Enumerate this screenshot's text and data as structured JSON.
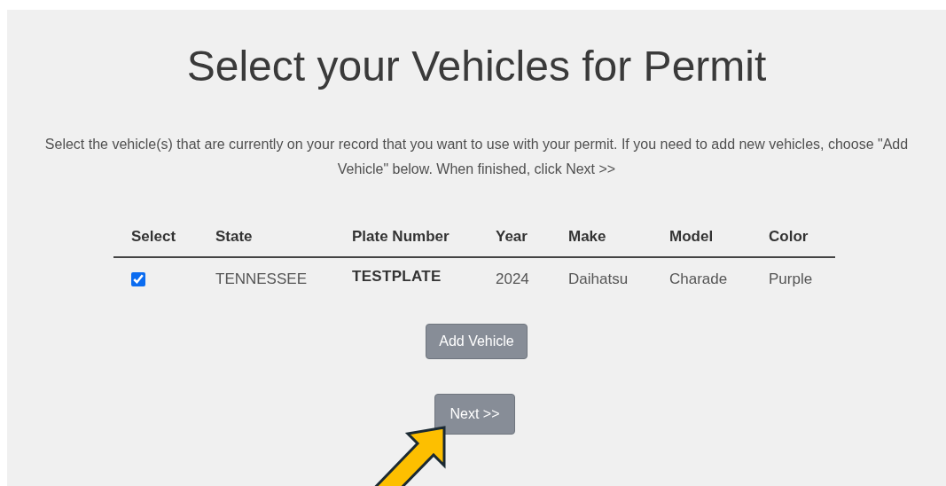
{
  "title": "Select your Vehicles for Permit",
  "instructions": "Select the vehicle(s) that are currently on your record that you want to use with your permit. If you need to add new vehicles, choose \"Add Vehicle\" below. When finished, click Next >>",
  "table": {
    "columns": [
      "Select",
      "State",
      "Plate Number",
      "Year",
      "Make",
      "Model",
      "Color"
    ],
    "rows": [
      {
        "selected": true,
        "cells": [
          "",
          "TENNESSEE",
          "TESTPLATE",
          "2024",
          "Daihatsu",
          "Charade",
          "Purple"
        ]
      }
    ]
  },
  "buttons": [
    {
      "kind": "add",
      "label": "Add Vehicle"
    },
    {
      "kind": "next",
      "label": "Next >>"
    }
  ]
}
